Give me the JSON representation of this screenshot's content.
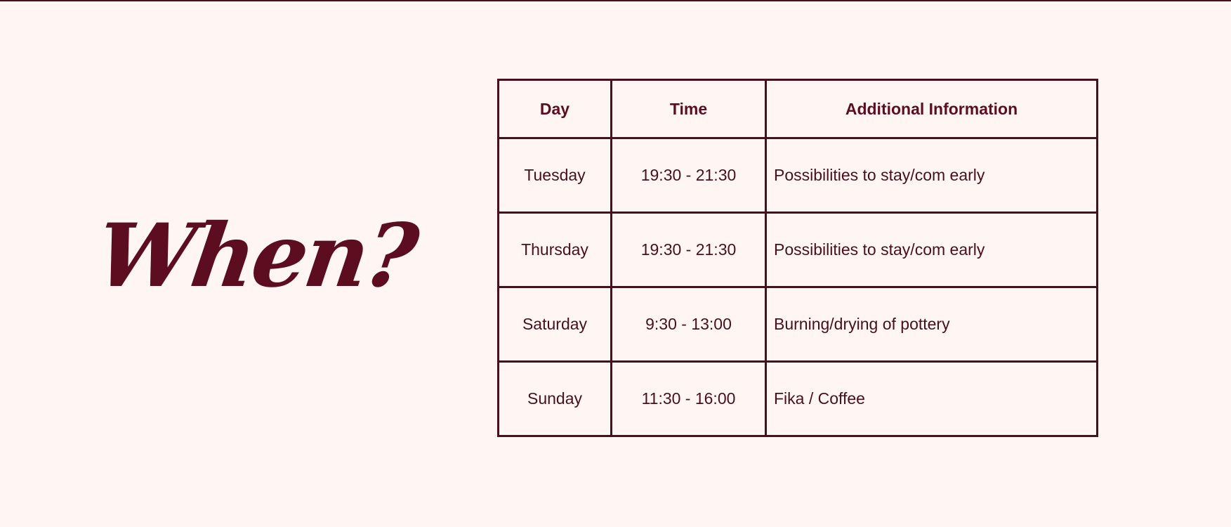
{
  "section": {
    "heading": "When?"
  },
  "schedule": {
    "headers": [
      "Day",
      "Time",
      "Additional Information"
    ],
    "rows": [
      {
        "day": "Tuesday",
        "time": "19:30 - 21:30",
        "info": "Possibilities to stay/com early"
      },
      {
        "day": "Thursday",
        "time": "19:30 - 21:30",
        "info": "Possibilities to stay/com early"
      },
      {
        "day": "Saturday",
        "time": "9:30 - 13:00",
        "info": "Burning/drying of pottery"
      },
      {
        "day": "Sunday",
        "time": "11:30 - 16:00",
        "info": "Fika / Coffee"
      }
    ]
  },
  "colors": {
    "background": "#fff6f4",
    "text": "#4a0f1e",
    "heading": "#5c0d20",
    "border": "#4a0f1e"
  }
}
